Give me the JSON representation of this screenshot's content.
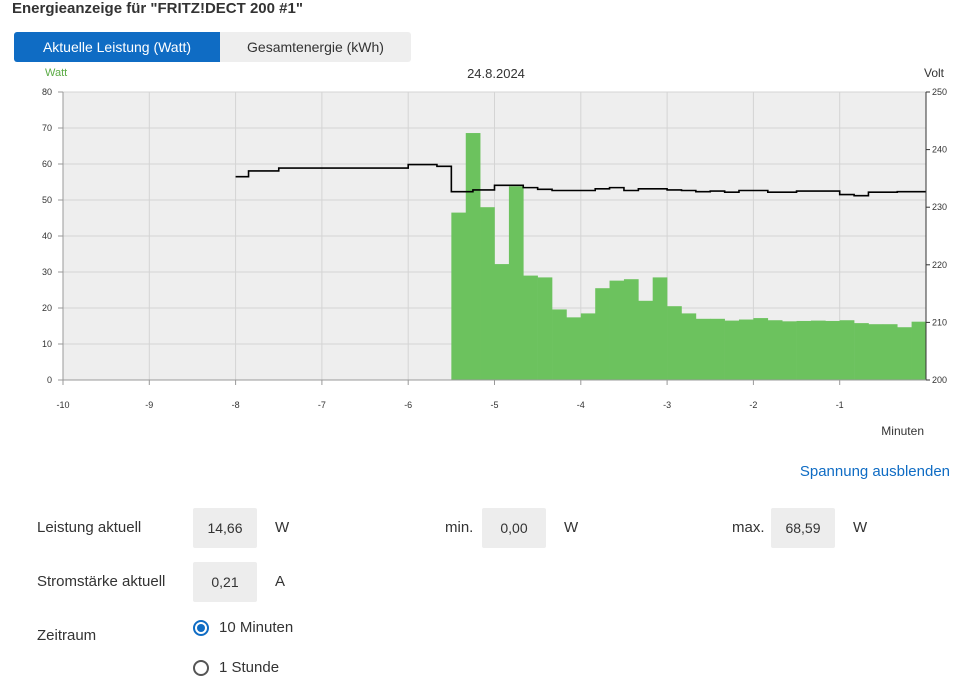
{
  "page": {
    "title": "Energieanzeige für \"FRITZ!DECT 200 #1\""
  },
  "tabs": [
    {
      "label": "Aktuelle Leistung (Watt)",
      "active": true
    },
    {
      "label": "Gesamtenergie (kWh)",
      "active": false
    }
  ],
  "chart": {
    "date_label": "24.8.2024",
    "y_left_unit": "Watt",
    "y_right_unit": "Volt",
    "x_unit": "Minuten"
  },
  "chart_data": {
    "type": "bar",
    "title": "24.8.2024",
    "xlabel": "Minuten",
    "ylabel": "Watt",
    "y2label": "Volt",
    "xlim": [
      -10,
      0
    ],
    "ylim": [
      0,
      80
    ],
    "y2lim": [
      200,
      250
    ],
    "x_ticks": [
      "-10",
      "-9",
      "-8",
      "-7",
      "-6",
      "-5",
      "-4",
      "-3",
      "-2",
      "-1"
    ],
    "y_ticks": [
      "0",
      "10",
      "20",
      "30",
      "40",
      "50",
      "60",
      "70",
      "80"
    ],
    "y2_ticks": [
      "200",
      "210",
      "220",
      "230",
      "240",
      "250"
    ],
    "grid": true,
    "colors": {
      "bars": "#6cc25e",
      "voltage": "#000000",
      "plot_bg": "#eeeeee",
      "grid": "#d4d4d4",
      "watt_label": "#5aab44"
    },
    "series": [
      {
        "name": "Leistung",
        "type": "bar",
        "bin_width_min": 0.1667,
        "x_start": [
          -5.5,
          -5.333,
          -5.167,
          -5.0,
          -4.833,
          -4.667,
          -4.5,
          -4.333,
          -4.167,
          -4.0,
          -3.833,
          -3.667,
          -3.5,
          -3.333,
          -3.167,
          -3.0,
          -2.833,
          -2.667,
          -2.5,
          -2.333,
          -2.167,
          -2.0,
          -1.833,
          -1.667,
          -1.5,
          -1.333,
          -1.167,
          -1.0,
          -0.833,
          -0.667,
          -0.5,
          -0.333,
          -0.167
        ],
        "values": [
          46.5,
          68.6,
          48.0,
          32.2,
          53.8,
          29.0,
          28.5,
          19.6,
          17.4,
          18.5,
          25.5,
          27.6,
          28.0,
          22.0,
          28.5,
          20.5,
          18.5,
          17.0,
          17.0,
          16.5,
          16.8,
          17.2,
          16.6,
          16.3,
          16.4,
          16.5,
          16.4,
          16.6,
          15.8,
          15.5,
          15.5,
          14.66,
          16.2
        ]
      },
      {
        "name": "Spannung",
        "type": "step",
        "x": [
          -8.0,
          -7.85,
          -7.5,
          -6.0,
          -5.667,
          -5.5,
          -5.25,
          -5.0,
          -4.667,
          -4.5,
          -4.333,
          -3.833,
          -3.667,
          -3.5,
          -3.333,
          -3.0,
          -2.833,
          -2.667,
          -2.5,
          -2.333,
          -2.167,
          -1.833,
          -1.5,
          -1.0,
          -0.833,
          -0.667,
          -0.333,
          0.0
        ],
        "values": [
          235.3,
          236.3,
          236.8,
          237.4,
          237.1,
          232.7,
          233.0,
          233.8,
          233.4,
          233.1,
          232.9,
          233.2,
          233.4,
          232.9,
          233.2,
          233.0,
          232.9,
          232.7,
          232.8,
          232.6,
          232.9,
          232.6,
          232.8,
          232.2,
          232.0,
          232.6,
          232.7,
          232.7
        ]
      }
    ]
  },
  "toggle_voltage_label": "Spannung ausblenden",
  "stats": {
    "power_label": "Leistung aktuell",
    "power_value": "14,66",
    "power_unit": "W",
    "min_label": "min.",
    "min_value": "0,00",
    "min_unit": "W",
    "max_label": "max.",
    "max_value": "68,59",
    "max_unit": "W",
    "current_label": "Stromstärke aktuell",
    "current_value": "0,21",
    "current_unit": "A"
  },
  "timerange": {
    "label": "Zeitraum",
    "options": [
      {
        "label": "10 Minuten",
        "checked": true
      },
      {
        "label": "1 Stunde",
        "checked": false
      }
    ]
  }
}
